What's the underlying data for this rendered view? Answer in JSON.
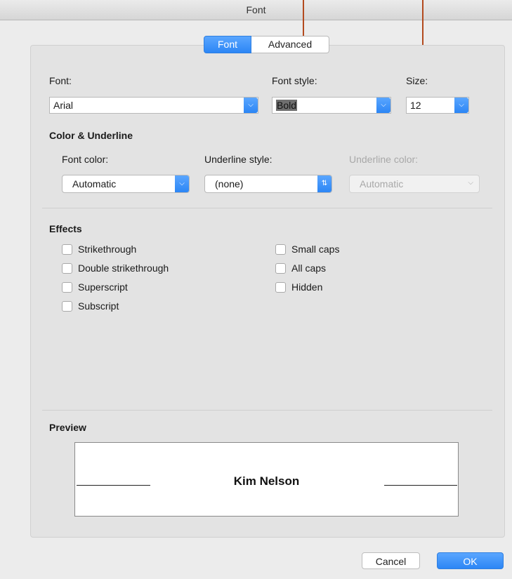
{
  "window": {
    "title": "Font"
  },
  "tabs": [
    {
      "label": "Font",
      "active": true
    },
    {
      "label": "Advanced",
      "active": false
    }
  ],
  "font": {
    "font_label": "Font:",
    "font_value": "Arial",
    "style_label": "Font style:",
    "style_value": "Bold",
    "size_label": "Size:",
    "size_value": "12"
  },
  "color_underline": {
    "heading": "Color & Underline",
    "font_color_label": "Font color:",
    "font_color_value": "Automatic",
    "underline_style_label": "Underline style:",
    "underline_style_value": "(none)",
    "underline_color_label": "Underline color:",
    "underline_color_value": "Automatic"
  },
  "effects": {
    "heading": "Effects",
    "left": [
      {
        "label": "Strikethrough",
        "checked": false
      },
      {
        "label": "Double strikethrough",
        "checked": false
      },
      {
        "label": "Superscript",
        "checked": false
      },
      {
        "label": "Subscript",
        "checked": false
      }
    ],
    "right": [
      {
        "label": "Small caps",
        "checked": false
      },
      {
        "label": "All caps",
        "checked": false
      },
      {
        "label": "Hidden",
        "checked": false
      }
    ]
  },
  "preview": {
    "heading": "Preview",
    "sample_text": "Kim Nelson"
  },
  "buttons": {
    "cancel": "Cancel",
    "ok": "OK"
  },
  "colors": {
    "accent": "#2c86f5",
    "annotation_arrow": "#b34a1e"
  },
  "icons": {
    "dropdown": "chevron-down-icon",
    "stepper": "up-down-chevron-icon"
  }
}
